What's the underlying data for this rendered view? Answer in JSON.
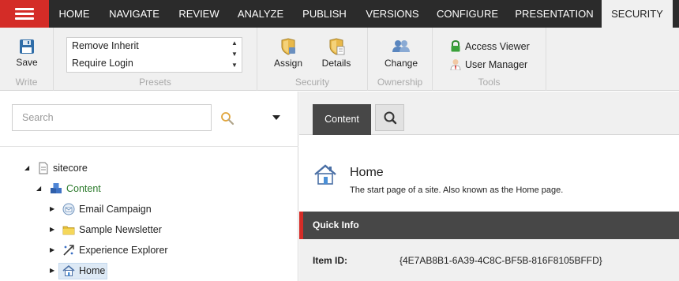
{
  "nav": {
    "tabs": [
      {
        "label": "HOME"
      },
      {
        "label": "NAVIGATE"
      },
      {
        "label": "REVIEW"
      },
      {
        "label": "ANALYZE"
      },
      {
        "label": "PUBLISH"
      },
      {
        "label": "VERSIONS"
      },
      {
        "label": "CONFIGURE"
      },
      {
        "label": "PRESENTATION"
      },
      {
        "label": "SECURITY"
      }
    ],
    "active_tab": "SECURITY"
  },
  "ribbon": {
    "write": {
      "save_label": "Save",
      "group_label": "Write"
    },
    "presets": {
      "options": [
        "Remove Inherit",
        "Require Login"
      ],
      "group_label": "Presets"
    },
    "security": {
      "assign_label": "Assign",
      "details_label": "Details",
      "group_label": "Security"
    },
    "ownership": {
      "change_label": "Change",
      "group_label": "Ownership"
    },
    "tools": {
      "access_viewer_label": "Access Viewer",
      "user_manager_label": "User Manager",
      "group_label": "Tools"
    }
  },
  "search": {
    "placeholder": "Search"
  },
  "tree": {
    "items": [
      {
        "label": "sitecore",
        "icon": "page-icon",
        "expanded": true
      },
      {
        "label": "Content",
        "icon": "content-cubes-icon",
        "expanded": true
      },
      {
        "label": "Email Campaign",
        "icon": "email-campaign-icon",
        "expanded": false
      },
      {
        "label": "Sample Newsletter",
        "icon": "folder-icon",
        "expanded": false
      },
      {
        "label": "Experience Explorer",
        "icon": "explorer-icon",
        "expanded": false
      },
      {
        "label": "Home",
        "icon": "home-icon",
        "expanded": false,
        "selected": true
      }
    ]
  },
  "editor": {
    "tabs": {
      "content_label": "Content"
    },
    "item_title": "Home",
    "item_description": "The start page of a site. Also known as the Home page.",
    "quick_info": {
      "header": "Quick Info",
      "item_id_label": "Item ID:",
      "item_id_value": "{4E7AB8B1-6A39-4C8C-BF5B-816F8105BFFD}"
    }
  },
  "colors": {
    "nav_bg": "#2b2b2b",
    "accent_red": "#d42c27",
    "ribbon_bg": "#f0f0f0",
    "dark_tab": "#474747",
    "selection_bg": "#dde9f5",
    "content_green": "#2a7a2a"
  }
}
